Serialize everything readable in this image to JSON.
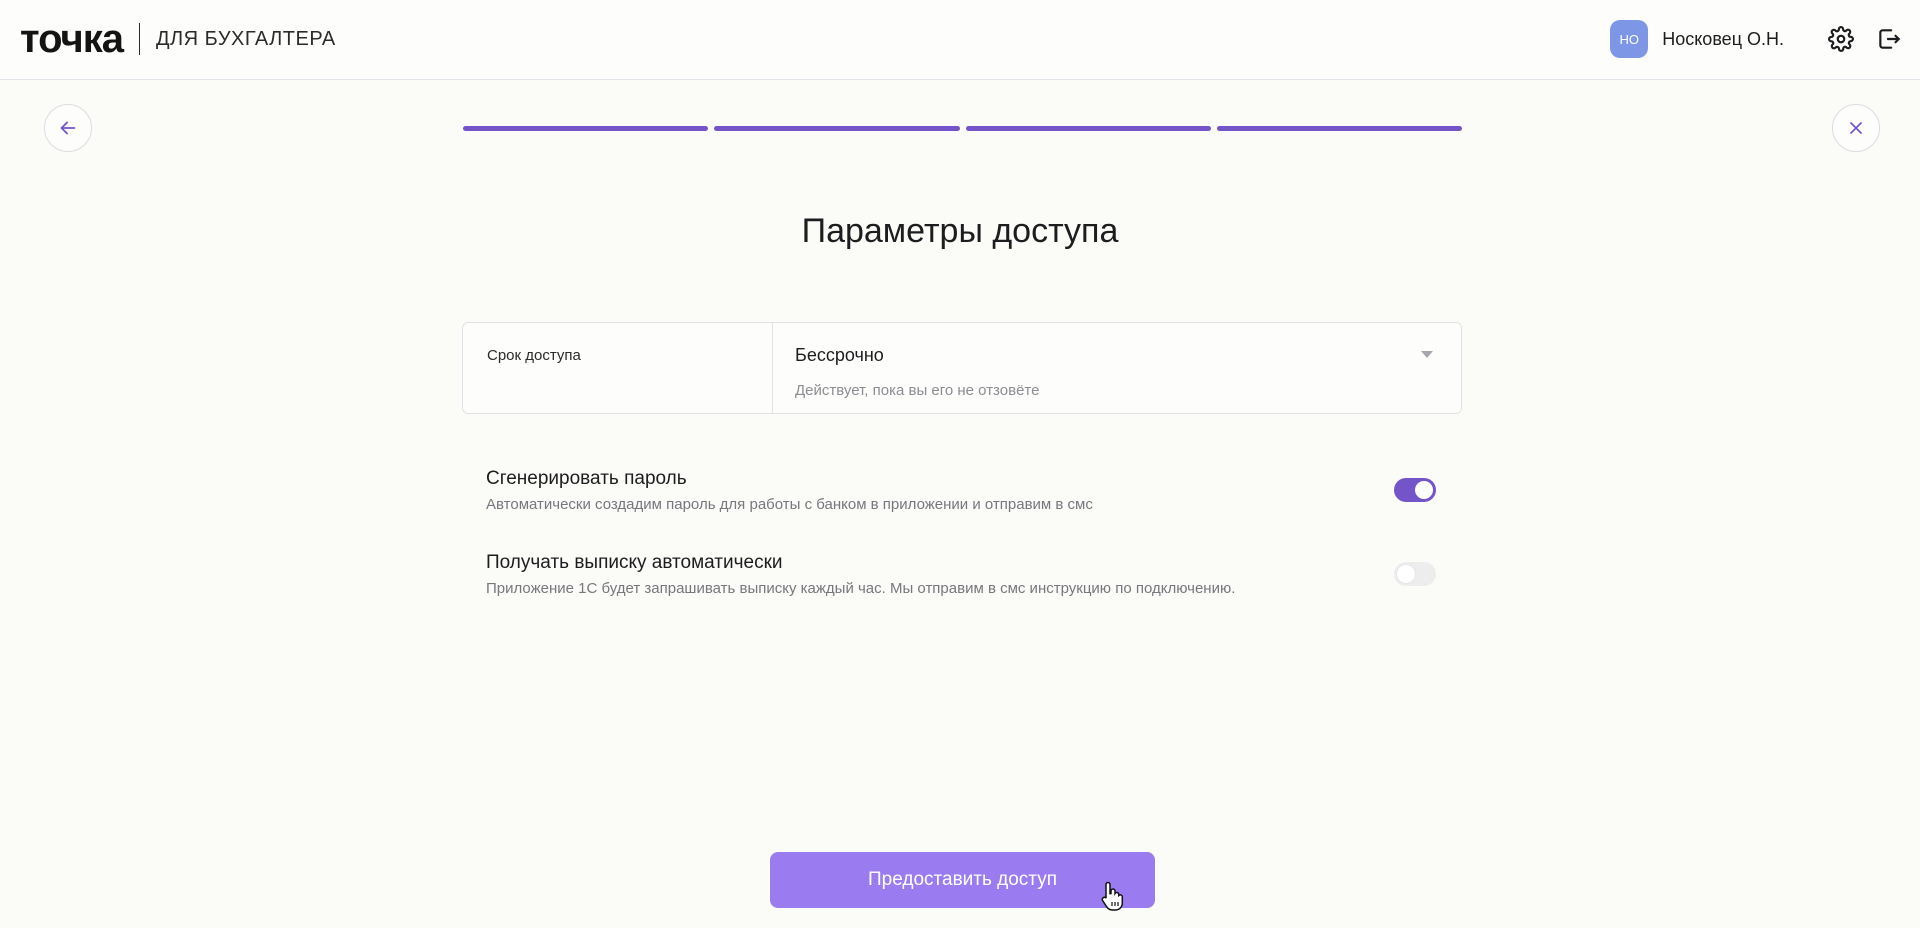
{
  "header": {
    "logo": "точка",
    "logo_sub": "ДЛЯ БУХГАЛТЕРА",
    "avatar_initials": "НО",
    "user_name": "Носковец О.Н."
  },
  "icons": {
    "back": "arrow-left-icon",
    "close": "close-icon",
    "settings": "gear-icon",
    "logout": "logout-icon",
    "cursor": "hand-pointer-cursor-icon"
  },
  "steps": {
    "total": 4,
    "completed": 4
  },
  "page_title": "Параметры доступа",
  "access_period": {
    "label": "Срок доступа",
    "value": "Бессрочно",
    "hint": "Действует, пока вы его не отзовёте"
  },
  "options": [
    {
      "title": "Сгенерировать пароль",
      "description": "Автоматически создадим пароль для работы с банком в приложении и отправим в смс",
      "enabled": true
    },
    {
      "title": "Получать выписку автоматически",
      "description": "Приложение 1С будет запрашивать выписку каждый час. Мы отправим в смс инструкцию по подключению.",
      "enabled": false
    }
  ],
  "submit_label": "Предоставить доступ",
  "colors": {
    "accent": "#7454c9",
    "button": "#9a7cf0",
    "avatar": "#7d97e6",
    "background": "#fbfbf8"
  }
}
